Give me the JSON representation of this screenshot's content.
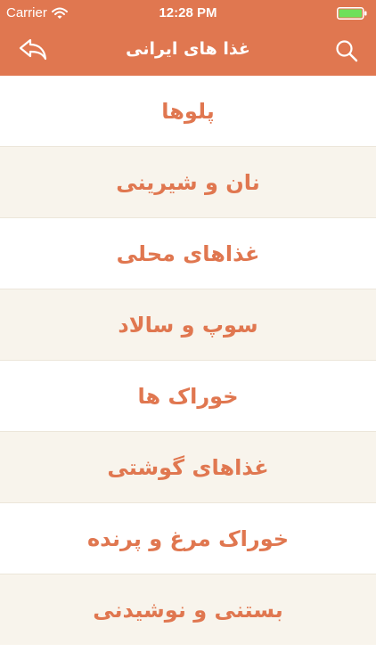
{
  "status_bar": {
    "carrier": "Carrier",
    "time": "12:28 PM",
    "battery_color": "#6ee05a"
  },
  "header": {
    "title": "غذا های ایرانی",
    "back_icon": "back-arrow-icon",
    "search_icon": "search-icon",
    "background": "#e07750"
  },
  "menu": {
    "items": [
      {
        "label": "پلوها"
      },
      {
        "label": "نان و شیرینی"
      },
      {
        "label": "غذاهای محلی"
      },
      {
        "label": "سوپ و سالاد"
      },
      {
        "label": "خوراک ها"
      },
      {
        "label": "غذاهای گوشتی"
      },
      {
        "label": "خوراک مرغ و پرنده"
      },
      {
        "label": "بستنی و نوشیدنی"
      }
    ]
  }
}
